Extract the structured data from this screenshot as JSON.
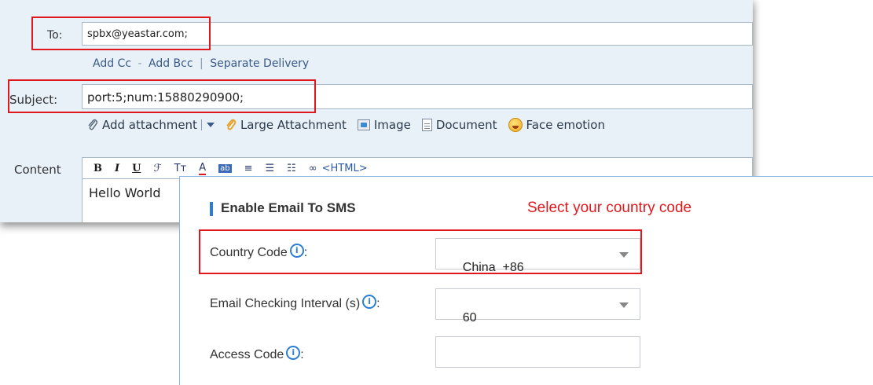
{
  "mail": {
    "to_label": "To:",
    "to_value": "spbx@yeastar.com;",
    "cc_links": {
      "add_cc": "Add Cc",
      "dash": "-",
      "add_bcc": "Add Bcc",
      "pipe": "|",
      "separate": "Separate Delivery"
    },
    "subject_label": "Subject:",
    "subject_value": "port:5;num:15880290900;",
    "attachments": {
      "add_attachment": "Add attachment",
      "large_attachment": "Large Attachment",
      "image": "Image",
      "document": "Document",
      "face_emotion": "Face emotion"
    },
    "content_label": "Content",
    "toolbar": {
      "bold": "B",
      "italic": "I",
      "underline": "U",
      "html": "<HTML>"
    },
    "body_text": "Hello World"
  },
  "settings": {
    "section_title": "Enable Email To SMS",
    "hint": "Select your country code",
    "fields": [
      {
        "label": "Country Code",
        "suffix": ":",
        "value": "China  +86",
        "type": "select"
      },
      {
        "label": "Email Checking Interval (s)",
        "suffix": ":",
        "value": "60",
        "type": "select"
      },
      {
        "label": "Access Code",
        "suffix": ":",
        "value": "",
        "type": "input"
      }
    ]
  },
  "colors": {
    "highlight": "#e0181e",
    "accent": "#2a7fd4",
    "panel_bg": "#e8f0f8"
  },
  "icons": [
    "paperclip-icon",
    "dropdown-arrow-icon",
    "large-attachment-icon",
    "image-icon",
    "document-icon",
    "face-emotion-icon",
    "info-icon",
    "select-caret-icon"
  ]
}
